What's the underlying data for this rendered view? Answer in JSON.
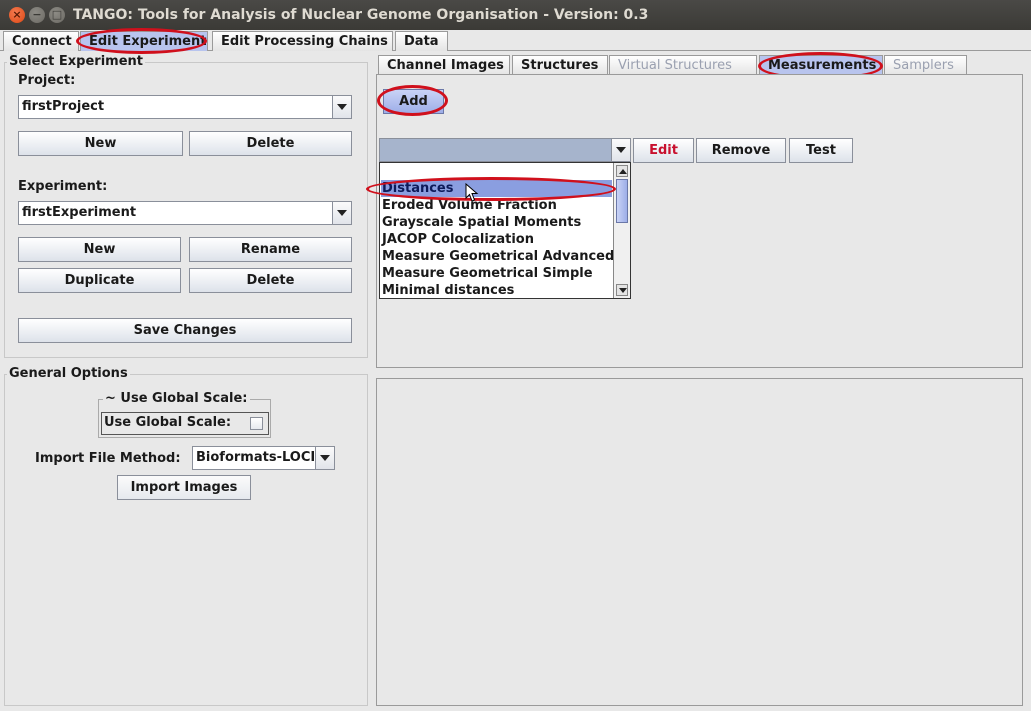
{
  "window": {
    "title": "TANGO: Tools for Analysis of Nuclear Genome Organisation - Version: 0.3"
  },
  "main_tabs": [
    "Connect",
    "Edit Experiment",
    "Edit Processing Chains",
    "Data"
  ],
  "select_experiment": {
    "title": "Select Experiment",
    "project_label": "Project:",
    "project_value": "firstProject",
    "project_new": "New",
    "project_delete": "Delete",
    "experiment_label": "Experiment:",
    "experiment_value": "firstExperiment",
    "exp_new": "New",
    "exp_rename": "Rename",
    "exp_duplicate": "Duplicate",
    "exp_delete": "Delete",
    "save": "Save Changes"
  },
  "general_options": {
    "title": "General Options",
    "global_scale_group": "~ Use Global Scale:",
    "global_scale_label": "Use Global Scale:",
    "global_scale_checked": false,
    "import_method_label": "Import File Method:",
    "import_method_value": "Bioformats-LOCI",
    "import_images": "Import Images"
  },
  "sub_tabs": [
    "Channel Images",
    "Structures",
    "Virtual Structures",
    "Measurements",
    "Samplers"
  ],
  "measurements": {
    "add": "Add",
    "edit": "Edit",
    "remove": "Remove",
    "test": "Test",
    "options": [
      "Distances",
      "Eroded Volume Fraction",
      "Grayscale Spatial Moments",
      "JACOP Colocalization",
      "Measure Geometrical Advanced",
      "Measure Geometrical Simple",
      "Minimal distances"
    ]
  },
  "colors": {
    "selected_tab": "#b8c4ee",
    "list_selection": "#8a9ee0",
    "highlight_ring": "#d0101c",
    "edit_text": "#c8102e"
  }
}
